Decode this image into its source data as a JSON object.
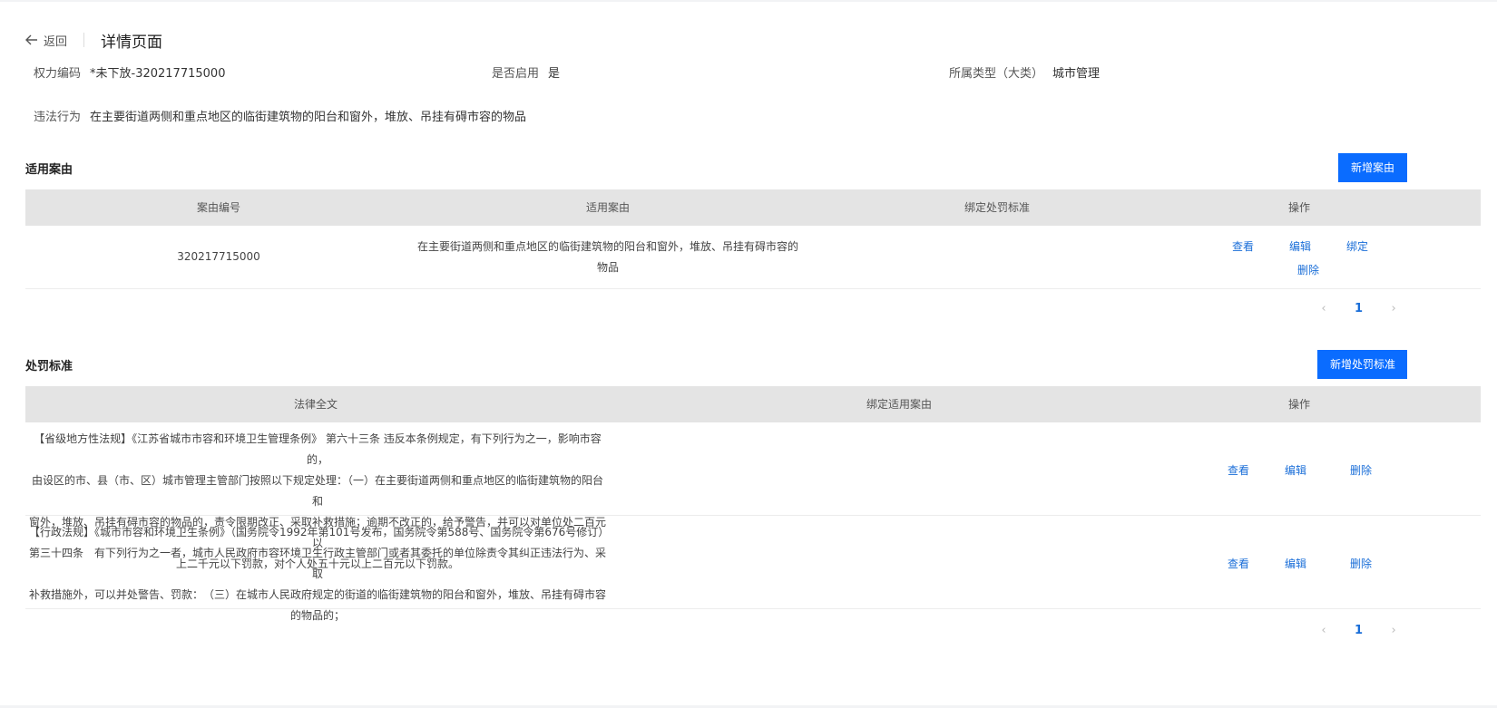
{
  "header": {
    "back_label": "返回",
    "title": "详情页面"
  },
  "info": {
    "power_code_label": "权力编码",
    "power_code_value": "*未下放-320217715000",
    "enabled_label": "是否启用",
    "enabled_value": "是",
    "category_label": "所属类型（大类）",
    "category_value": "城市管理",
    "violation_label": "违法行为",
    "violation_value": "在主要街道两侧和重点地区的临街建筑物的阳台和窗外，堆放、吊挂有碍市容的物品"
  },
  "cases": {
    "title": "适用案由",
    "add_button": "新增案由",
    "columns": [
      "案由编号",
      "适用案由",
      "绑定处罚标准",
      "操作"
    ],
    "rows": [
      {
        "code": "320217715000",
        "reason_line1": "在主要街道两侧和重点地区的临街建筑物的阳台和窗外，堆放、吊挂有碍市容的",
        "reason_line2": "物品",
        "standard": "",
        "actions": {
          "view": "查看",
          "edit": "编辑",
          "bind": "绑定",
          "delete": "删除"
        }
      }
    ],
    "pager": {
      "page": "1",
      "prev": "‹",
      "next": "›"
    }
  },
  "penalties": {
    "title": "处罚标准",
    "add_button": "新增处罚标准",
    "columns": [
      "法律全文",
      "绑定适用案由",
      "操作"
    ],
    "rows": [
      {
        "lines": [
          "【省级地方性法规】《江苏省城市市容和环境卫生管理条例》 第六十三条 违反本条例规定，有下列行为之一，影响市容的，",
          "由设区的市、县（市、区）城市管理主管部门按照以下规定处理：（一）在主要街道两侧和重点地区的临街建筑物的阳台和",
          "窗外，堆放、吊挂有碍市容的物品的，责令限期改正、采取补救措施；逾期不改正的，给予警告，并可以对单位处二百元以",
          "上二千元以下罚款，对个人处五十元以上二百元以下罚款。"
        ],
        "bound": "",
        "actions": {
          "view": "查看",
          "edit": "编辑",
          "delete": "删除"
        }
      },
      {
        "lines": [
          "【行政法规】《城市市容和环境卫生条例》（国务院令1992年第101号发布，国务院令第588号、国务院令第676号修订）",
          "第三十四条　有下列行为之一者，城市人民政府市容环境卫生行政主管部门或者其委托的单位除责令其纠正违法行为、采取",
          "补救措施外，可以并处警告、罚款：　（三）在城市人民政府规定的街道的临街建筑物的阳台和窗外，堆放、吊挂有碍市容",
          "的物品的；"
        ],
        "bound": "",
        "actions": {
          "view": "查看",
          "edit": "编辑",
          "delete": "删除"
        }
      }
    ],
    "pager": {
      "page": "1",
      "prev": "‹",
      "next": "›"
    }
  },
  "colors": {
    "primary": "#0a6cff",
    "link": "#1a6ed8",
    "header_bg": "#e4e4e4"
  }
}
